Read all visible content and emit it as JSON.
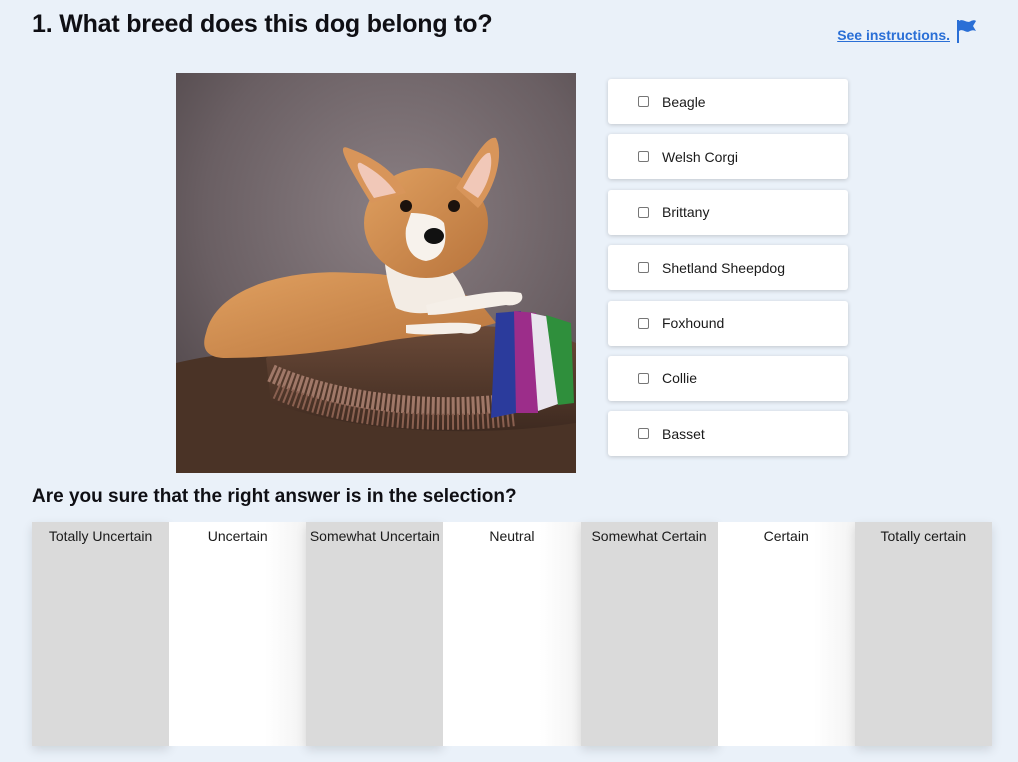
{
  "question": {
    "title": "1. What breed does this dog belong to?"
  },
  "instructions": {
    "link_text": "See instructions.",
    "icon": "flag-icon"
  },
  "image": {
    "subject": "dog-photo"
  },
  "options": [
    {
      "label": "Beagle",
      "checked": false
    },
    {
      "label": "Welsh Corgi",
      "checked": false
    },
    {
      "label": "Brittany",
      "checked": false
    },
    {
      "label": "Shetland Sheepdog",
      "checked": false
    },
    {
      "label": "Foxhound",
      "checked": false
    },
    {
      "label": "Collie",
      "checked": false
    },
    {
      "label": "Basset",
      "checked": false
    }
  ],
  "certainty": {
    "question": "Are you sure that the right answer is in the selection?",
    "levels": [
      "Totally Uncertain",
      "Uncertain",
      "Somewhat Uncertain",
      "Neutral",
      "Somewhat Certain",
      "Certain",
      "Totally certain"
    ]
  },
  "colors": {
    "background": "#eaf1f9",
    "link": "#2a6fd6",
    "scale_gray": "#dadada"
  }
}
